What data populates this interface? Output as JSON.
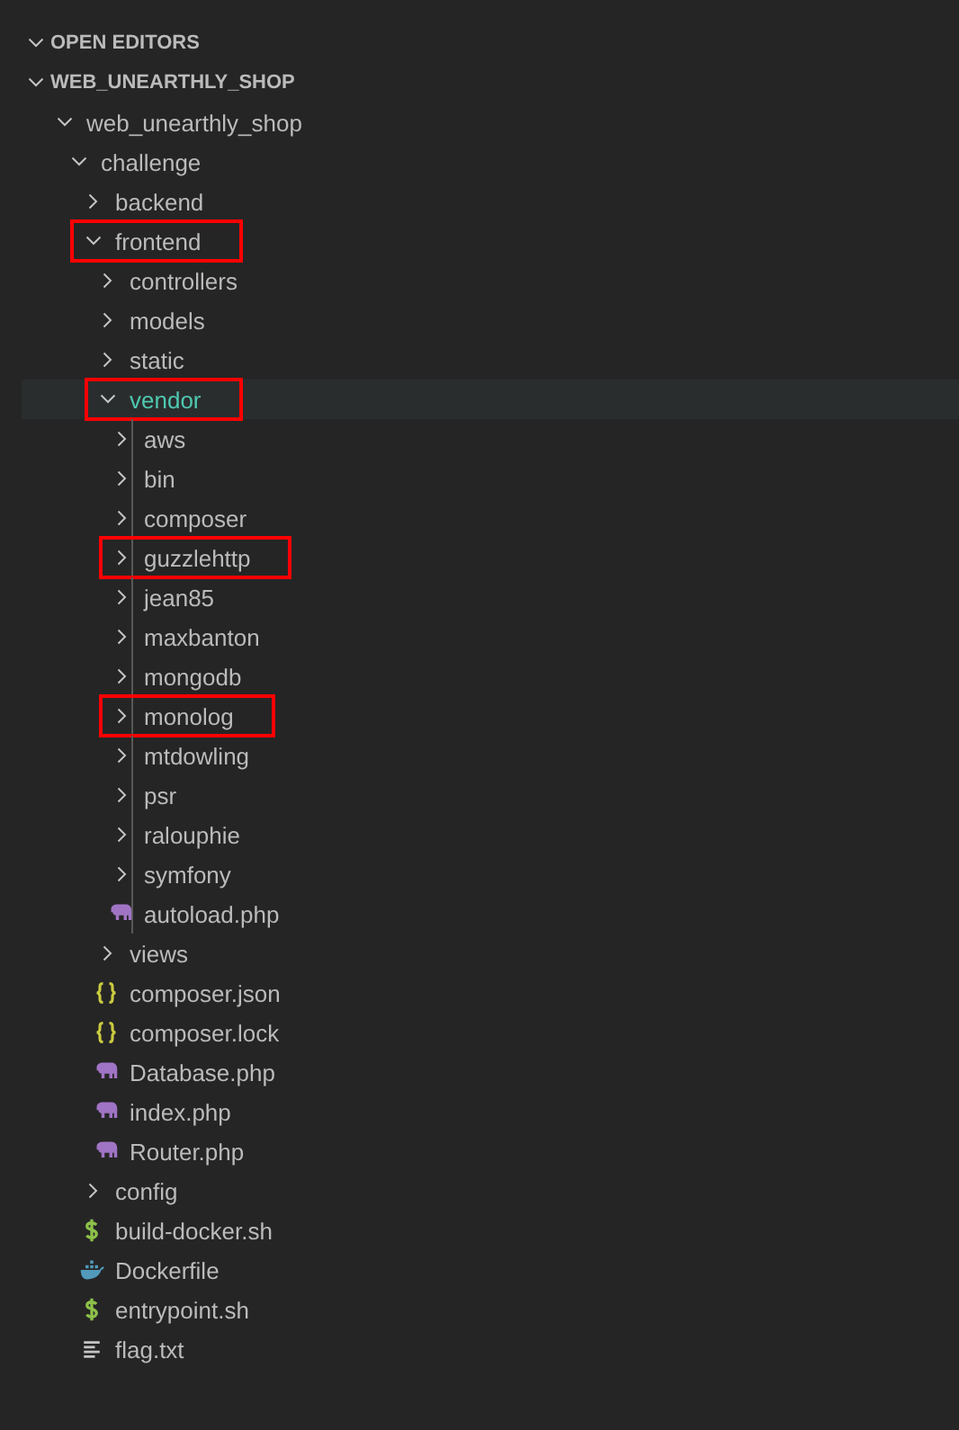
{
  "sections": [
    {
      "title": "OPEN EDITORS",
      "expanded": true
    },
    {
      "title": "WEB_UNEARTHLY_SHOP",
      "expanded": true
    }
  ],
  "tree": [
    {
      "name": "web_unearthly_shop",
      "kind": "folder",
      "expanded": true,
      "selected": false,
      "highlighted": false,
      "children": [
        {
          "name": "challenge",
          "kind": "folder",
          "expanded": true,
          "selected": false,
          "highlighted": false,
          "children": [
            {
              "name": "backend",
              "kind": "folder",
              "expanded": false,
              "selected": false,
              "highlighted": false
            },
            {
              "name": "frontend",
              "kind": "folder",
              "expanded": true,
              "selected": false,
              "highlighted": true,
              "children": [
                {
                  "name": "controllers",
                  "kind": "folder",
                  "expanded": false,
                  "selected": false,
                  "highlighted": false
                },
                {
                  "name": "models",
                  "kind": "folder",
                  "expanded": false,
                  "selected": false,
                  "highlighted": false
                },
                {
                  "name": "static",
                  "kind": "folder",
                  "expanded": false,
                  "selected": false,
                  "highlighted": false
                },
                {
                  "name": "vendor",
                  "kind": "folder",
                  "expanded": true,
                  "selected": true,
                  "highlighted": true,
                  "children": [
                    {
                      "name": "aws",
                      "kind": "folder",
                      "expanded": false,
                      "selected": false,
                      "highlighted": false
                    },
                    {
                      "name": "bin",
                      "kind": "folder",
                      "expanded": false,
                      "selected": false,
                      "highlighted": false
                    },
                    {
                      "name": "composer",
                      "kind": "folder",
                      "expanded": false,
                      "selected": false,
                      "highlighted": false
                    },
                    {
                      "name": "guzzlehttp",
                      "kind": "folder",
                      "expanded": false,
                      "selected": false,
                      "highlighted": true
                    },
                    {
                      "name": "jean85",
                      "kind": "folder",
                      "expanded": false,
                      "selected": false,
                      "highlighted": false
                    },
                    {
                      "name": "maxbanton",
                      "kind": "folder",
                      "expanded": false,
                      "selected": false,
                      "highlighted": false
                    },
                    {
                      "name": "mongodb",
                      "kind": "folder",
                      "expanded": false,
                      "selected": false,
                      "highlighted": false
                    },
                    {
                      "name": "monolog",
                      "kind": "folder",
                      "expanded": false,
                      "selected": false,
                      "highlighted": true
                    },
                    {
                      "name": "mtdowling",
                      "kind": "folder",
                      "expanded": false,
                      "selected": false,
                      "highlighted": false
                    },
                    {
                      "name": "psr",
                      "kind": "folder",
                      "expanded": false,
                      "selected": false,
                      "highlighted": false
                    },
                    {
                      "name": "ralouphie",
                      "kind": "folder",
                      "expanded": false,
                      "selected": false,
                      "highlighted": false
                    },
                    {
                      "name": "symfony",
                      "kind": "folder",
                      "expanded": false,
                      "selected": false,
                      "highlighted": false
                    },
                    {
                      "name": "autoload.php",
                      "kind": "php",
                      "selected": false,
                      "highlighted": false
                    }
                  ]
                },
                {
                  "name": "views",
                  "kind": "folder",
                  "expanded": false,
                  "selected": false,
                  "highlighted": false
                },
                {
                  "name": "composer.json",
                  "kind": "json",
                  "selected": false,
                  "highlighted": false
                },
                {
                  "name": "composer.lock",
                  "kind": "json",
                  "selected": false,
                  "highlighted": false
                },
                {
                  "name": "Database.php",
                  "kind": "php",
                  "selected": false,
                  "highlighted": false
                },
                {
                  "name": "index.php",
                  "kind": "php",
                  "selected": false,
                  "highlighted": false
                },
                {
                  "name": "Router.php",
                  "kind": "php",
                  "selected": false,
                  "highlighted": false
                }
              ]
            },
            {
              "name": "config",
              "kind": "folder",
              "expanded": false,
              "selected": false,
              "highlighted": false
            },
            {
              "name": "build-docker.sh",
              "kind": "shell",
              "selected": false,
              "highlighted": false
            },
            {
              "name": "Dockerfile",
              "kind": "docker",
              "selected": false,
              "highlighted": false
            },
            {
              "name": "entrypoint.sh",
              "kind": "shell",
              "selected": false,
              "highlighted": false
            },
            {
              "name": "flag.txt",
              "kind": "text",
              "selected": false,
              "highlighted": false
            }
          ]
        }
      ]
    }
  ]
}
